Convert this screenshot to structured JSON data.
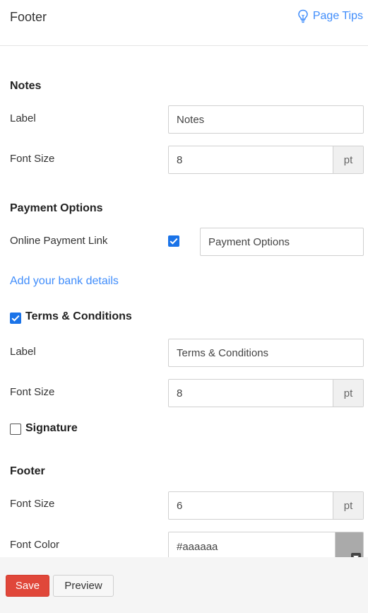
{
  "header": {
    "title": "Footer",
    "page_tips_label": "Page Tips",
    "page_tips_icon": "lightbulb-icon"
  },
  "notes": {
    "title": "Notes",
    "label_text": "Label",
    "label_value": "Notes",
    "font_size_text": "Font Size",
    "font_size_value": "8",
    "font_size_unit": "pt"
  },
  "payment_options": {
    "title": "Payment Options",
    "online_payment_link_text": "Online Payment Link",
    "online_payment_link_checked": true,
    "online_payment_link_value": "Payment Options",
    "bank_details_link": "Add your bank details"
  },
  "terms": {
    "checkbox_label": "Terms & Conditions",
    "checked": true,
    "label_text": "Label",
    "label_value": "Terms & Conditions",
    "font_size_text": "Font Size",
    "font_size_value": "8",
    "font_size_unit": "pt"
  },
  "signature": {
    "checkbox_label": "Signature",
    "checked": false
  },
  "footer_section": {
    "title": "Footer",
    "font_size_text": "Font Size",
    "font_size_value": "6",
    "font_size_unit": "pt",
    "font_color_text": "Font Color",
    "font_color_value": "#aaaaaa"
  },
  "actions": {
    "save_label": "Save",
    "preview_label": "Preview"
  },
  "colors": {
    "accent": "#408dfb",
    "checkbox": "#1a73e8",
    "save_button": "#e0473a",
    "swatch": "#aaaaaa"
  }
}
